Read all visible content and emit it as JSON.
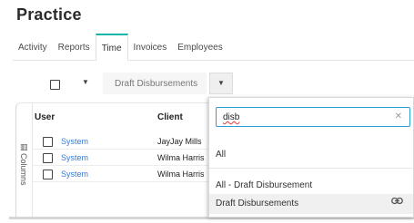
{
  "page": {
    "title": "Practice"
  },
  "tabs": [
    {
      "label": "Activity",
      "active": false
    },
    {
      "label": "Reports",
      "active": false
    },
    {
      "label": "Time",
      "active": true
    },
    {
      "label": "Invoices",
      "active": false
    },
    {
      "label": "Employees",
      "active": false
    }
  ],
  "toolbar": {
    "view_selected": "Draft Disbursements"
  },
  "grid": {
    "columns_panel_label": "Columns",
    "headers": {
      "user": "User",
      "client": "Client"
    },
    "rows": [
      {
        "user": "System",
        "client": "JayJay Mills"
      },
      {
        "user": "System",
        "client": "Wilma Harris"
      },
      {
        "user": "System",
        "client": "Wilma Harris"
      }
    ]
  },
  "dropdown": {
    "search_value": "disb",
    "clear_icon": "close-icon",
    "options": [
      "All",
      "All - Draft Disbursement",
      "Draft Disbursements"
    ],
    "selected_option_icon": "link-icon"
  },
  "colors": {
    "accent": "#10b5a9",
    "link": "#3a7bd5",
    "focus": "#2f9bd8"
  }
}
